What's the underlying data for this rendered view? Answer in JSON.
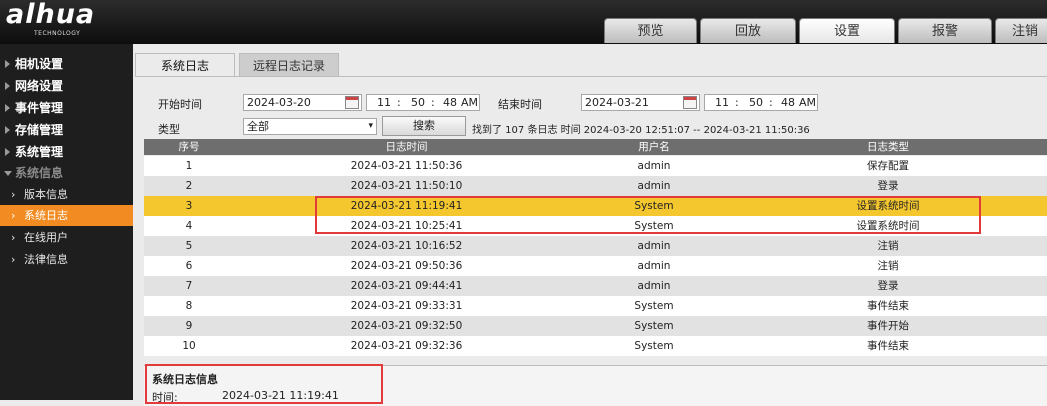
{
  "brand": {
    "logo": "alhua",
    "tagline": "TECHNOLOGY"
  },
  "top_tabs": [
    {
      "label": "预览",
      "active": false
    },
    {
      "label": "回放",
      "active": false
    },
    {
      "label": "设置",
      "active": true
    },
    {
      "label": "报警",
      "active": false
    },
    {
      "label": "注销",
      "active": false
    }
  ],
  "sidebar": {
    "main_items": [
      {
        "label": "相机设置",
        "expanded": false
      },
      {
        "label": "网络设置",
        "expanded": false
      },
      {
        "label": "事件管理",
        "expanded": false
      },
      {
        "label": "存储管理",
        "expanded": false
      },
      {
        "label": "系统管理",
        "expanded": false
      },
      {
        "label": "系统信息",
        "expanded": true
      }
    ],
    "sub_items": [
      {
        "label": "版本信息",
        "active": false
      },
      {
        "label": "系统日志",
        "active": true
      },
      {
        "label": "在线用户",
        "active": false
      },
      {
        "label": "法律信息",
        "active": false
      }
    ]
  },
  "content_tabs": {
    "syslog": "系统日志",
    "remote": "远程日志记录"
  },
  "search": {
    "start_label": "开始时间",
    "start_date": "2024-03-20",
    "start_h": "11",
    "start_m": "50",
    "start_s": "48",
    "start_ampm": "AM",
    "end_label": "结束时间",
    "end_date": "2024-03-21",
    "end_h": "11",
    "end_m": "50",
    "end_s": "48",
    "end_ampm": "AM",
    "sep": ":",
    "type_label": "类型",
    "type_value": "全部",
    "search_button": "搜索",
    "result_text": "找到了 107 条日志 时间 2024-03-20 12:51:07 -- 2024-03-21 11:50:36"
  },
  "table": {
    "headers": [
      "序号",
      "日志时间",
      "用户名",
      "日志类型"
    ],
    "rows": [
      [
        "1",
        "2024-03-21 11:50:36",
        "admin",
        "保存配置"
      ],
      [
        "2",
        "2024-03-21 11:50:10",
        "admin",
        "登录"
      ],
      [
        "3",
        "2024-03-21 11:19:41",
        "System",
        "设置系统时间"
      ],
      [
        "4",
        "2024-03-21 10:25:41",
        "System",
        "设置系统时间"
      ],
      [
        "5",
        "2024-03-21 10:16:52",
        "admin",
        "注销"
      ],
      [
        "6",
        "2024-03-21 09:50:36",
        "admin",
        "注销"
      ],
      [
        "7",
        "2024-03-21 09:44:41",
        "admin",
        "登录"
      ],
      [
        "8",
        "2024-03-21 09:33:31",
        "System",
        "事件结束"
      ],
      [
        "9",
        "2024-03-21 09:32:50",
        "System",
        "事件开始"
      ],
      [
        "10",
        "2024-03-21 09:32:36",
        "System",
        "事件结束"
      ]
    ],
    "selected_row": 3
  },
  "details": {
    "title": "系统日志信息",
    "time_label": "时间:",
    "time_value": "2024-03-21 11:19:41"
  },
  "colors": {
    "accent": "#f28c22",
    "selected_row": "#f5c72f",
    "highlight_box": "#e23a3a"
  }
}
